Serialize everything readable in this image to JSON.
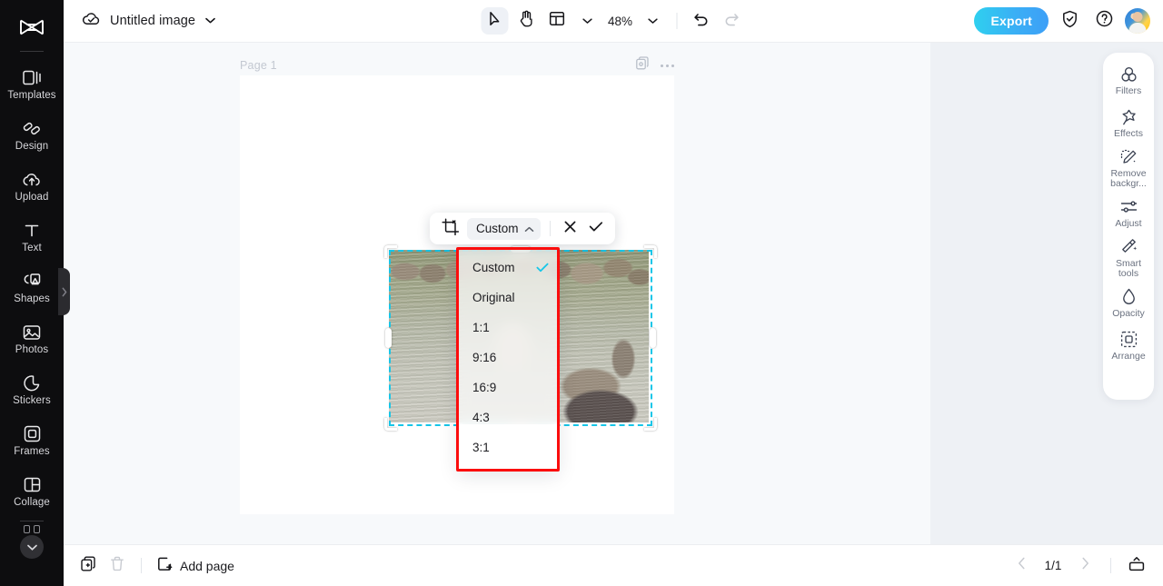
{
  "app": {
    "brand_icon": "capcut-logo-icon"
  },
  "sidebar": {
    "items": [
      {
        "label": "Templates",
        "icon": "templates-icon"
      },
      {
        "label": "Design",
        "icon": "design-icon"
      },
      {
        "label": "Upload",
        "icon": "upload-cloud-icon"
      },
      {
        "label": "Text",
        "icon": "text-icon"
      },
      {
        "label": "Shapes",
        "icon": "shapes-icon"
      },
      {
        "label": "Photos",
        "icon": "photos-icon"
      },
      {
        "label": "Stickers",
        "icon": "stickers-icon"
      },
      {
        "label": "Frames",
        "icon": "frames-icon"
      },
      {
        "label": "Collage",
        "icon": "collage-icon"
      }
    ],
    "more_icon": "more-apps-icon",
    "expand_icon": "chevron-down-icon",
    "collapse_tab_icon": "chevron-right-icon"
  },
  "topbar": {
    "cloud_icon": "cloud-saved-icon",
    "doc_title": "Untitled image",
    "doc_menu_icon": "chevron-down-icon",
    "tools": {
      "select_icon": "cursor-select-icon",
      "hand_icon": "hand-pan-icon",
      "layout_icon": "layout-grid-icon",
      "layout_chevron_icon": "chevron-down-icon",
      "zoom_level": "48%",
      "zoom_chevron_icon": "chevron-down-icon",
      "undo_icon": "undo-icon",
      "redo_icon": "redo-icon"
    },
    "export_label": "Export",
    "shield_icon": "shield-check-icon",
    "help_icon": "help-question-icon",
    "avatar_icon": "user-avatar"
  },
  "canvas": {
    "page_label": "Page 1",
    "duplicate_icon": "duplicate-page-icon",
    "more_icon": "more-options-icon"
  },
  "crop_toolbar": {
    "crop_icon": "crop-icon",
    "ratio_label": "Custom",
    "ratio_chevron_icon": "chevron-up-icon",
    "cancel_icon": "close-x-icon",
    "confirm_icon": "checkmark-icon"
  },
  "ratio_menu": {
    "selected": "Custom",
    "check_icon": "checkmark-icon",
    "items": [
      {
        "label": "Custom",
        "checked": true
      },
      {
        "label": "Original",
        "checked": false
      },
      {
        "label": "1:1",
        "checked": false
      },
      {
        "label": "9:16",
        "checked": false
      },
      {
        "label": "16:9",
        "checked": false
      },
      {
        "label": "4:3",
        "checked": false
      },
      {
        "label": "3:1",
        "checked": false
      }
    ]
  },
  "right_panel": {
    "items": [
      {
        "label": "Filters",
        "icon": "filters-icon"
      },
      {
        "label": "Effects",
        "icon": "effects-sparkle-icon"
      },
      {
        "label": "Remove\nbackgr...",
        "icon": "remove-background-icon"
      },
      {
        "label": "Adjust",
        "icon": "adjust-sliders-icon"
      },
      {
        "label": "Smart\ntools",
        "icon": "smart-tools-wand-icon"
      },
      {
        "label": "Opacity",
        "icon": "opacity-drop-icon"
      },
      {
        "label": "Arrange",
        "icon": "arrange-icon"
      }
    ]
  },
  "bottombar": {
    "duplicate_icon": "duplicate-icon",
    "delete_icon": "trash-icon",
    "add_page_label": "Add page",
    "add_page_icon": "add-page-icon",
    "prev_icon": "chevron-left-icon",
    "page_count": "1/1",
    "next_icon": "chevron-right-icon",
    "present_icon": "present-icon"
  },
  "colors": {
    "accent_cyan": "#17c6e8",
    "export_gradient_start": "#2fd0ef",
    "export_gradient_end": "#3d9ff7",
    "highlight_red": "#fb0d0d",
    "sidebar_bg": "#0d0d0f"
  }
}
